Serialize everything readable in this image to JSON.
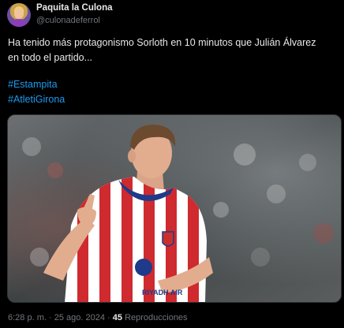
{
  "author": {
    "display_name": "Paquita la Culona",
    "handle": "@culonadeferrol"
  },
  "tweet": {
    "text_line1": "Ha tenido más protagonismo Sorloth en 10 minutos que Julián Álvarez",
    "text_line2": "en todo el partido...",
    "hashtags": [
      "#Estampita",
      "#AtletiGirona"
    ]
  },
  "media": {
    "description_icon": "photo",
    "sponsor_text": "RIYADH AIR"
  },
  "meta": {
    "time": "6:28 p. m.",
    "separator": "·",
    "date": "25 ago. 2024",
    "views_count": "45",
    "views_label": "Reproducciones"
  },
  "colors": {
    "background": "#000000",
    "text": "#e7e9ea",
    "secondary": "#71767b",
    "link": "#1d9bf0"
  }
}
